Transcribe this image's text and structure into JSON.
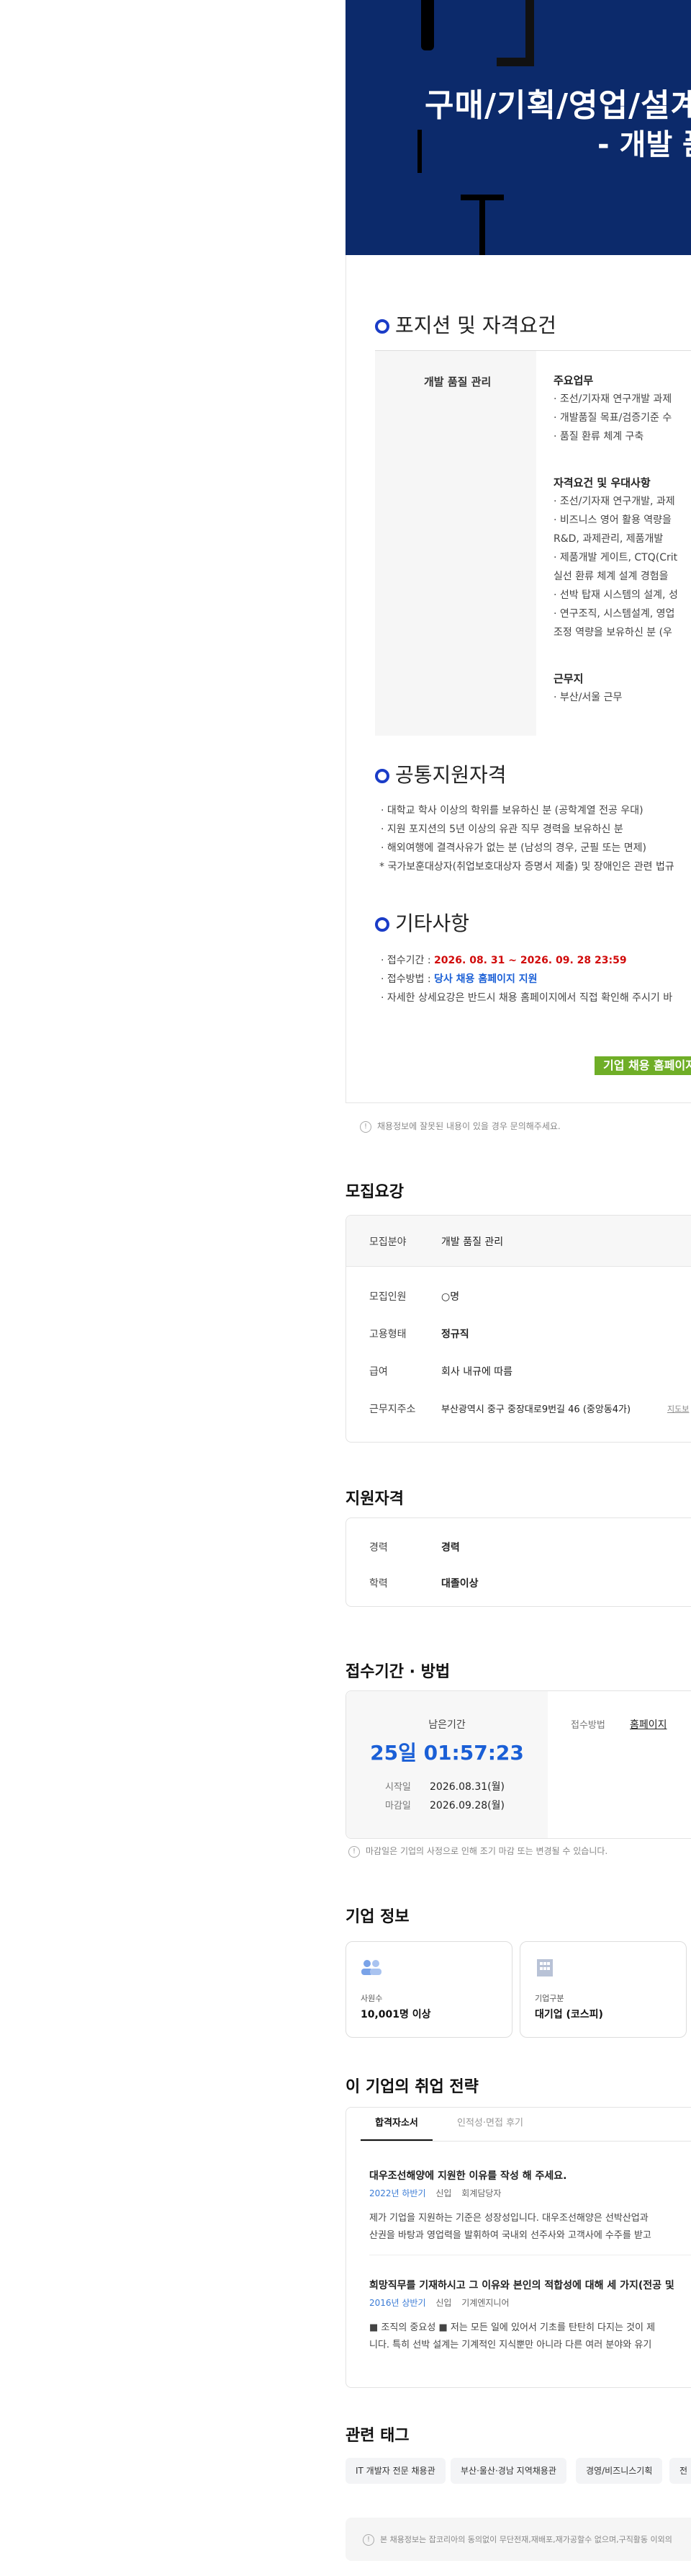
{
  "hero": {
    "title_line1": "구매/기획/영업/설계",
    "title_line2": "- 개발 품"
  },
  "posting": {
    "section1_title": "포지션 및 자격요건",
    "position_name": "개발 품질 관리",
    "duties_heading": "주요업무",
    "duties": [
      "· 조선/기자재 연구개발 과제",
      "· 개발품질 목표/검증기준 수",
      "· 품질 환류 체계 구축"
    ],
    "qual_heading": "자격요건 및 우대사항",
    "quals": [
      "· 조선/기자재 연구개발, 과제",
      "· 비즈니스 영어 활용 역량을",
      "  R&D, 과제관리, 제품개발 ",
      "· 제품개발 게이트, CTQ(Crit",
      "  실선 환류 체계 설계 경험을",
      "· 선박 탑재 시스템의 설계, 성",
      "· 연구조직, 시스템설계, 영업",
      "  조정 역량을 보유하신 분 (우"
    ],
    "location_heading": "근무지",
    "location": "· 부산/서울 근무",
    "section2_title": "공통지원자격",
    "common": [
      "· 대학교 학사 이상의 학위를 보유하신 분 (공학계열 전공 우대)",
      "· 지원 포지션의 5년 이상의 유관 직무 경력을 보유하신 분",
      "· 해외여행에 결격사유가 없는 분 (남성의 경우, 군필 또는 면제)",
      "* 국가보훈대상자(취업보호대상자 증명서 제출) 및 장애인은 관련 법규"
    ],
    "section3_title": "기타사항",
    "etc_period_label": "· 접수기간 : ",
    "etc_period_value": "2026. 08. 31 ~ 2026. 09. 28  23:59",
    "etc_method_label": "· 접수방법 : ",
    "etc_method_value": "당사 채용 홈페이지 지원",
    "etc_detail": "· 자세한 상세요강은 반드시 채용 홈페이지에서 직접 확인해 주시기 바",
    "homepage_button": "기업 채용 홈페이지"
  },
  "report_note": "채용정보에 잘못된 내용이 있을 경우 문의해주세요.",
  "recruit": {
    "title": "모집요강",
    "field_label": "모집분야",
    "field_value": "개발 품질 관리",
    "rows": [
      {
        "label": "모집인원",
        "value": "○명"
      },
      {
        "label": "고용형태",
        "value": "정규직"
      },
      {
        "label": "급여",
        "value": "회사 내규에 따름"
      },
      {
        "label": "근무지주소",
        "value": "부산광역시 중구 중장대로9번길 46 (중앙동4가)"
      }
    ],
    "map_link": "지도보"
  },
  "qualification": {
    "title": "지원자격",
    "rows": [
      {
        "label": "경력",
        "value": "경력"
      },
      {
        "label": "학력",
        "value": "대졸이상"
      }
    ]
  },
  "apply": {
    "title": "접수기간 · 방법",
    "remain_label": "남은기간",
    "remain_value": "25일 01:57:23",
    "start_label": "시작일",
    "start_value": "2026.08.31(월)",
    "end_label": "마감일",
    "end_value": "2026.09.28(월)",
    "method_label": "접수방법",
    "method_value": "홈페이지",
    "note": "마감일은 기업의 사정으로 인해 조기 마감 또는 변경될 수 있습니다."
  },
  "company": {
    "title": "기업 정보",
    "employees_label": "사원수",
    "employees_value": "10,001명 이상",
    "type_label": "기업구분",
    "type_value": "대기업 (코스피)"
  },
  "strategy": {
    "title": "이 기업의 취업 전략",
    "tab_active": "합격자소서",
    "tab_other": "인적성·면접 후기",
    "q1": "대우조선해양에 지원한 이유를 작성 해 주세요.",
    "q1_meta": "2022년 하반기",
    "q1_meta2": "신입",
    "q1_meta3": "회계담당자",
    "q1_body1": "제가 기업을 지원하는 기준은 성장성입니다. 대우조선해양은 선박산업과",
    "q1_body2": "산권을 바탕과 영업력을 발휘하여 국내외 선주사와 고객사에 수주를 받고",
    "q2": "희망직무를 기재하시고 그 이유와 본인의 적합성에 대해 세 가지(전공 및",
    "q2_meta": "2016년 상반기",
    "q2_meta2": "신입",
    "q2_meta3": "기계엔지니어",
    "q2_body1": "■ 조직의 중요성 ■ 저는 모든 일에 있어서 기초를 탄탄히 다지는 것이 제",
    "q2_body2": "니다. 특히 선박 설계는 기계적인 지식뿐만 아니라 다른 여러 분야와 유기"
  },
  "tags": {
    "title": "관련 태그",
    "items": [
      "IT 개발자 전문 채용관",
      "부산·울산·경남 지역채용관",
      "경영/비즈니스기획",
      "전"
    ]
  },
  "footer_note": "본 채용정보는 잡코리아의 동의없이 무단전재,재배포,재가공할수 없으며,구직활동 이외의"
}
